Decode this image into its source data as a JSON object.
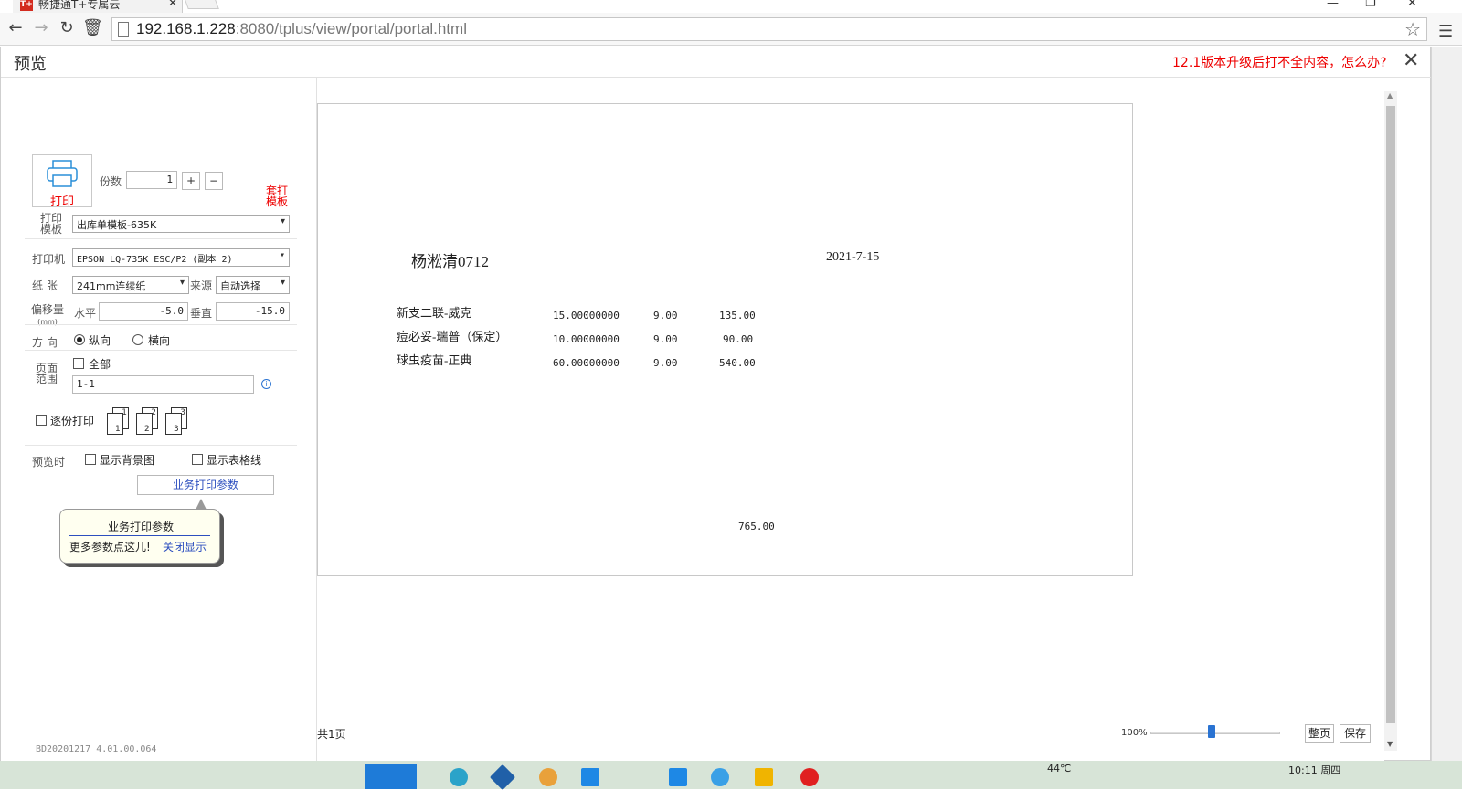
{
  "browser": {
    "tab_title": "畅捷通T+专属云",
    "tab_close": "✕",
    "url_host": "192.168.1.228",
    "url_port": ":8080",
    "url_path": "/tplus/view/portal/portal.html",
    "icons": [
      "back-icon",
      "forward-icon",
      "reload-icon",
      "trash-icon",
      "star-icon",
      "menu-icon"
    ]
  },
  "dialog": {
    "title": "预览",
    "help_link": "12.1版本升级后打不全内容，怎么办?",
    "close": "✕"
  },
  "print_panel": {
    "print_label": "打印",
    "copies_label": "份数",
    "copies_value": "1",
    "plus": "+",
    "minus": "−",
    "template_print_label": "套打模板",
    "template_label": "打印模板",
    "template_value": "出库单模板-635K",
    "printer_label": "打印机",
    "printer_value": "EPSON LQ-735K ESC/P2 (副本 2)",
    "paper_label": "纸  张",
    "paper_value": "241mm连续纸",
    "source_label": "来源",
    "source_value": "自动选择",
    "offset_label": "偏移量",
    "offset_unit": "(mm)",
    "horizontal_label": "水平",
    "horizontal_value": "-5.0",
    "vertical_label": "垂直",
    "vertical_value": "-15.0",
    "orientation_label": "方  向",
    "portrait_label": "纵向",
    "landscape_label": "横向",
    "orientation_selected": "portrait",
    "range_label": "页面范围",
    "all_label": "全部",
    "range_value": "1-1",
    "collate_label": "逐份打印",
    "preview_label": "预览时",
    "show_bg_label": "显示背景图",
    "show_grid_label": "显示表格线",
    "biz_params_button": "业务打印参数",
    "version": "BD20201217 4.01.00.064"
  },
  "tooltip": {
    "title": "业务打印参数",
    "message": "更多参数点这儿!",
    "close_link": "关闭显示"
  },
  "document": {
    "customer": "杨淞清0712",
    "date": "2021-7-15",
    "rows": [
      {
        "name": "新支二联-威克",
        "qty": "15.00000000",
        "price": "9.00",
        "amount": "135.00"
      },
      {
        "name": "痘必妥-瑞普（保定）",
        "qty": "10.00000000",
        "price": "9.00",
        "amount": "90.00"
      },
      {
        "name": "球虫疫苗-正典",
        "qty": "60.00000000",
        "price": "9.00",
        "amount": "540.00"
      }
    ],
    "total": "765.00"
  },
  "preview_footer": {
    "page_count": "共1页",
    "zoom": "100%",
    "fit_page": "整页",
    "save": "保存"
  },
  "taskbar": {
    "temperature": "44℃",
    "clock": "10:11 周四"
  }
}
